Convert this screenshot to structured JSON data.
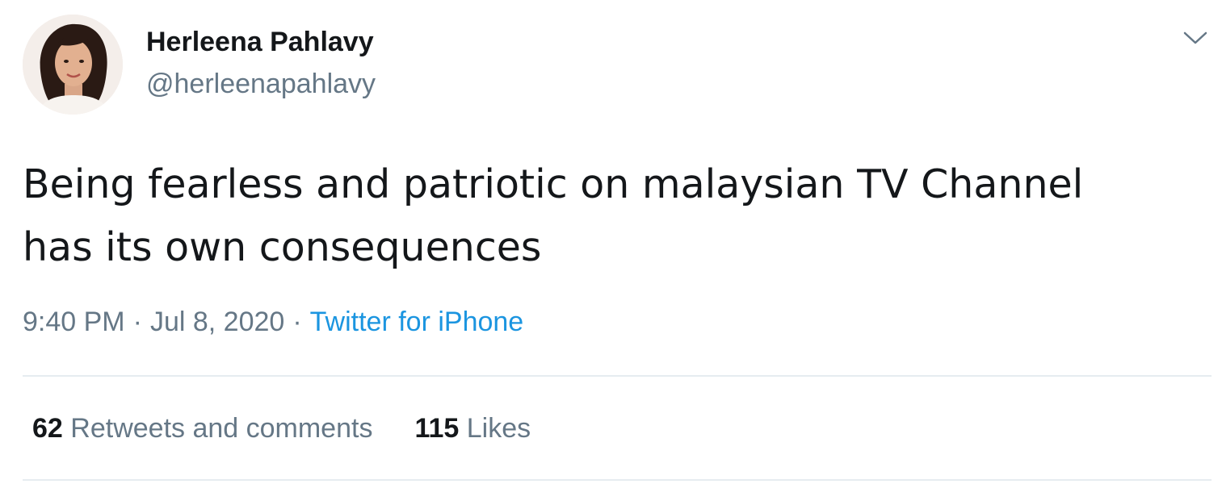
{
  "author": {
    "display_name": "Herleena Pahlavy",
    "handle": "@herleenapahlavy",
    "avatar_icon": "profile-photo"
  },
  "menu_icon": "chevron-down-icon",
  "tweet": {
    "line1": "Being fearless and patriotic on malaysian TV Channel",
    "line2": "has its own consequences"
  },
  "meta": {
    "time": "9:40 PM",
    "separator": "·",
    "date": "Jul 8, 2020",
    "source": "Twitter for iPhone"
  },
  "stats": {
    "retweets_count": "62",
    "retweets_label": "Retweets and comments",
    "likes_count": "115",
    "likes_label": "Likes"
  },
  "colors": {
    "text": "#14171a",
    "secondary": "#657786",
    "link": "#1b95e0",
    "divider": "#e6ecf0"
  }
}
